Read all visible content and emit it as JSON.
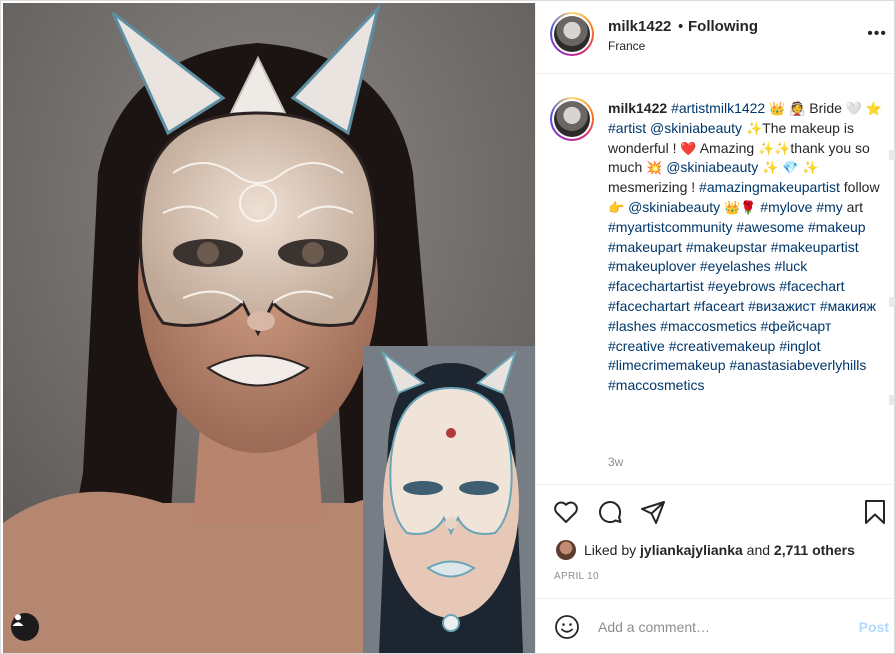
{
  "header": {
    "username": "milk1422",
    "separator": "•",
    "follow_status": "Following",
    "location": "France",
    "more_icon": "more-horizontal-icon"
  },
  "caption": {
    "username": "milk1422",
    "lines": [
      "#artistmilk1422",
      "Bride",
      "#artist",
      "@skiniabeauty",
      "The makeup is wonderful !",
      "Amazing",
      "thank you so much",
      "@skiniabeauty",
      "mesmerizing !",
      "#amazingmakeupartist",
      "follow",
      "@skiniabeauty",
      "#mylove",
      "#my",
      "art",
      "#myartistcommunity",
      "#awesome",
      "#makeup",
      "#makeupart",
      "#makeupstar",
      "#makeupartist",
      "#makeuplover",
      "#eyelashes",
      "#luck",
      "#facechartartist",
      "#eyebrows",
      "#facechart",
      "#facechartart",
      "#faceart",
      "#визажист",
      "#макияж",
      "#lashes",
      "#maccosmetics",
      "#фейсчарт",
      "#creative",
      "#creativemakeup",
      "#inglot",
      "#limecrimemakeup",
      "#anastasiabeverlyhills",
      "#maccosmetics"
    ],
    "emoji": [
      "👑",
      "👰",
      "🤍",
      "⭐",
      "✨",
      "❤️",
      "✨",
      "✨",
      "💥",
      "✨",
      "💎",
      "✨",
      "👉",
      "👑",
      "🌹"
    ],
    "time_ago": "3w"
  },
  "actions": {
    "like_icon": "heart-icon",
    "comment_icon": "comment-icon",
    "share_icon": "send-icon",
    "save_icon": "bookmark-icon"
  },
  "likes": {
    "prefix": "Liked by",
    "user": "jyliankajylianka",
    "middle": "and",
    "count": "2,711 others"
  },
  "date": "APRIL 10",
  "comment_box": {
    "placeholder": "Add a comment…",
    "post_label": "Post"
  },
  "colors": {
    "hashtag": "#00376b",
    "post_disabled": "#b3dbff",
    "muted": "#8e8e8e",
    "text": "#262626"
  }
}
